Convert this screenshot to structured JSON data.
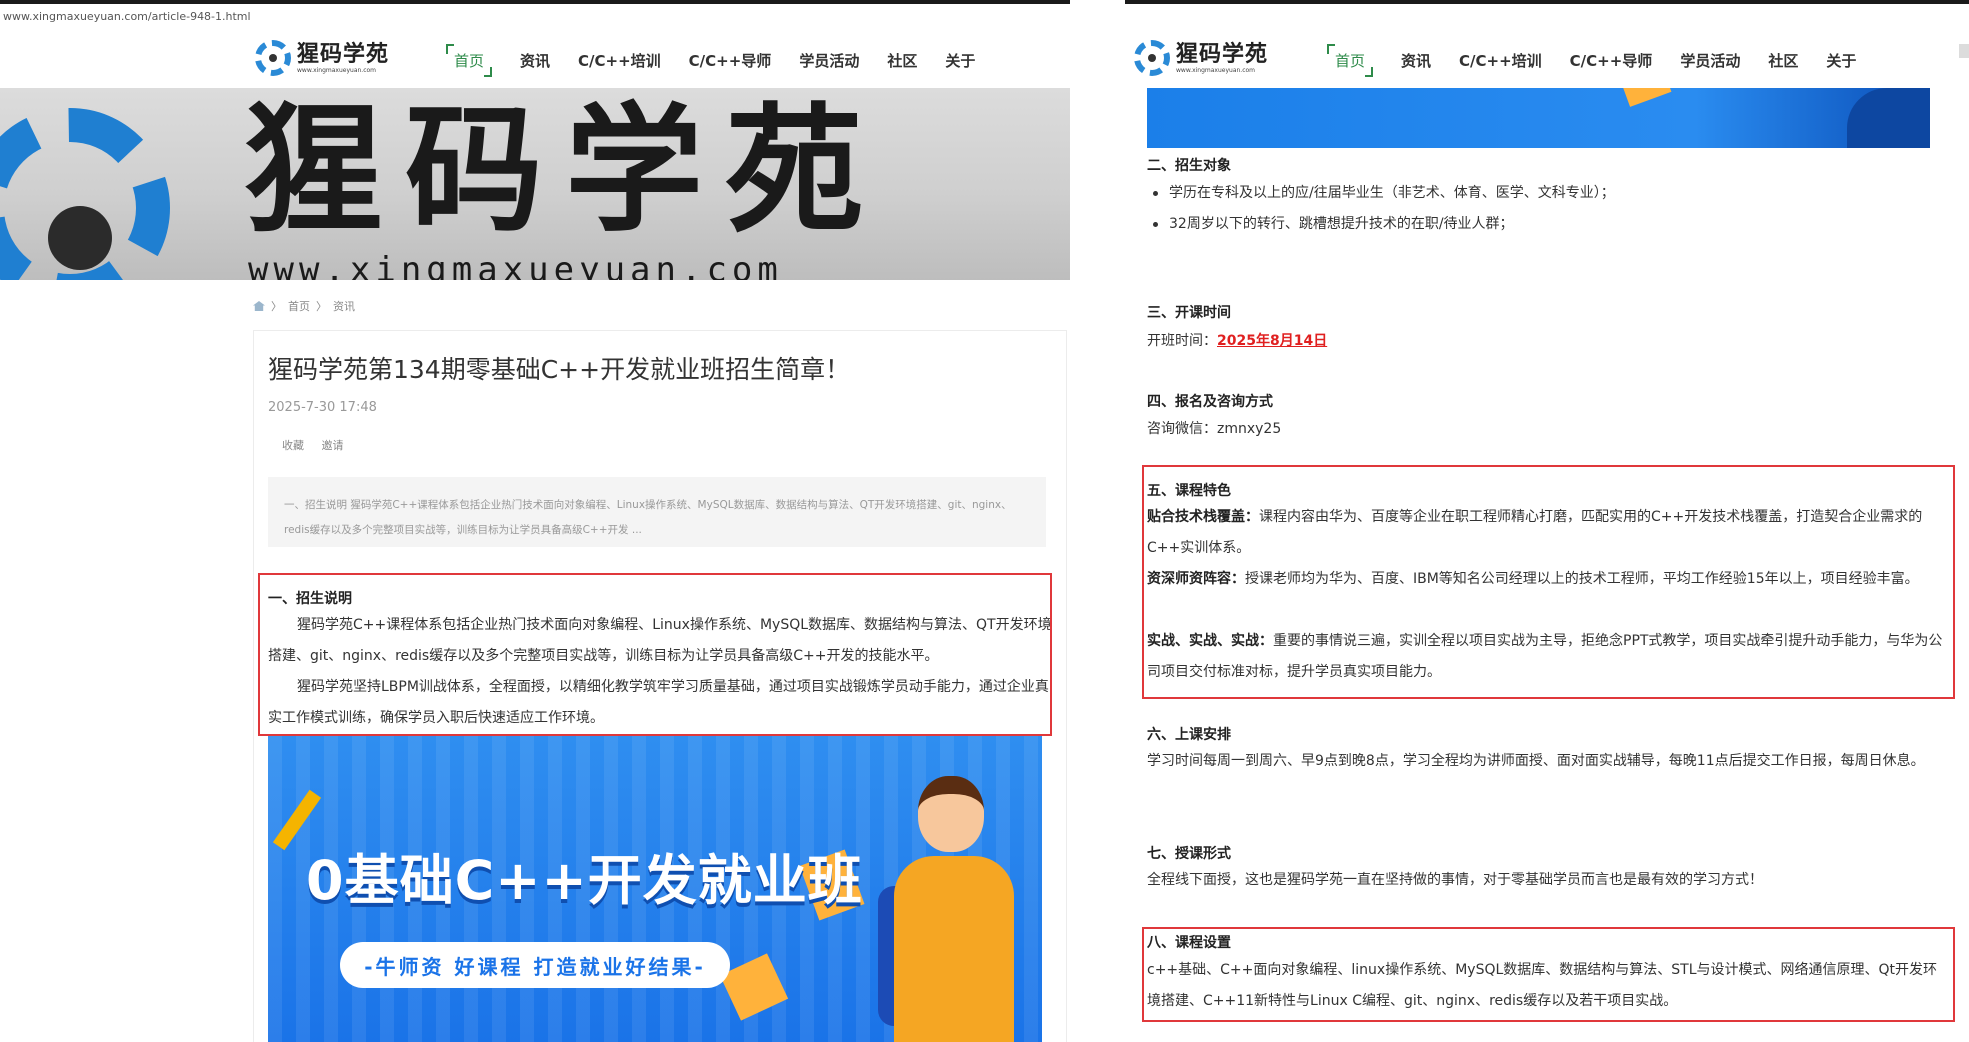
{
  "left": {
    "url": "www.xingmaxueyuan.com/article-948-1.html",
    "logo": {
      "name": "猩码学苑",
      "url": "www.xingmaxueyuan.com"
    },
    "nav": [
      "首页",
      "资讯",
      "C/C++培训",
      "C/C++导师",
      "学员活动",
      "社区",
      "关于"
    ],
    "hero": {
      "text": "猩码学苑",
      "url": "www.xingmaxueyuan.com"
    },
    "breadcrumb": {
      "home": "首页",
      "current": "资讯",
      "sep": "〉"
    },
    "article": {
      "title": "猩码学苑第134期零基础C++开发就业班招生简章！",
      "date": "2025-7-30 17:48",
      "actions": [
        "收藏",
        "邀请"
      ],
      "summary": "一、招生说明 猩码学苑C++课程体系包括企业热门技术面向对象编程、Linux操作系统、MySQL数据库、数据结构与算法、QT开发环境搭建、git、nginx、redis缓存以及多个完整项目实战等，训练目标为让学员具备高级C++开发 ...",
      "section1_title": "一、招生说明",
      "section1_p1": "猩码学苑C++课程体系包括企业热门技术面向对象编程、Linux操作系统、MySQL数据库、数据结构与算法、QT开发环境搭建、git、nginx、redis缓存以及多个完整项目实战等，训练目标为让学员具备高级C++开发的技能水平。",
      "section1_p2": "猩码学苑坚持LBPM训战体系，全程面授，以精细化教学筑牢学习质量基础，通过项目实战锻炼学员动手能力，通过企业真实工作模式训练，确保学员入职后快速适应工作环境。"
    },
    "banner": {
      "title": "0基础C++开发就业班",
      "tagline": "-牛师资 好课程 打造就业好结果-"
    }
  },
  "right": {
    "logo": {
      "name": "猩码学苑",
      "url": "www.xingmaxueyuan.com"
    },
    "nav": [
      "首页",
      "资讯",
      "C/C++培训",
      "C/C++导师",
      "学员活动",
      "社区",
      "关于"
    ],
    "s2": {
      "title": "二、招生对象",
      "items": [
        "学历在专科及以上的应/往届毕业生（非艺术、体育、医学、文科专业）；",
        "32周岁以下的转行、跳槽想提升技术的在职/待业人群；"
      ]
    },
    "s3": {
      "title": "三、开课时间",
      "label": "开班时间：",
      "date": "2025年8月14日"
    },
    "s4": {
      "title": "四、报名及咨询方式",
      "text": "咨询微信：zmnxy25"
    },
    "s5": {
      "title": "五、课程特色",
      "f1_label": "贴合技术栈覆盖：",
      "f1_text": "课程内容由华为、百度等企业在职工程师精心打磨，匹配实用的C++开发技术栈覆盖，打造契合企业需求的C++实训体系。",
      "f2_label": "资深师资阵容：",
      "f2_text": "授课老师均为华为、百度、IBM等知名公司经理以上的技术工程师，平均工作经验15年以上，项目经验丰富。",
      "f3_label": "实战、实战、实战：",
      "f3_text": "重要的事情说三遍，实训全程以项目实战为主导，拒绝念PPT式教学，项目实战牵引提升动手能力，与华为公司项目交付标准对标，提升学员真实项目能力。"
    },
    "s6": {
      "title": "六、上课安排",
      "text": "学习时间每周一到周六、早9点到晚8点，学习全程均为讲师面授、面对面实战辅导，每晚11点后提交工作日报，每周日休息。"
    },
    "s7": {
      "title": "七、授课形式",
      "text": "全程线下面授，这也是猩码学苑一直在坚持做的事情，对于零基础学员而言也是最有效的学习方式！"
    },
    "s8": {
      "title": "八、课程设置",
      "text": "c++基础、C++面向对象编程、linux操作系统、MySQL数据库、数据结构与算法、STL与设计模式、网络通信原理、Qt开发环境搭建、C++11新特性与Linux C编程、git、nginx、redis缓存以及若干项目实战。"
    }
  }
}
